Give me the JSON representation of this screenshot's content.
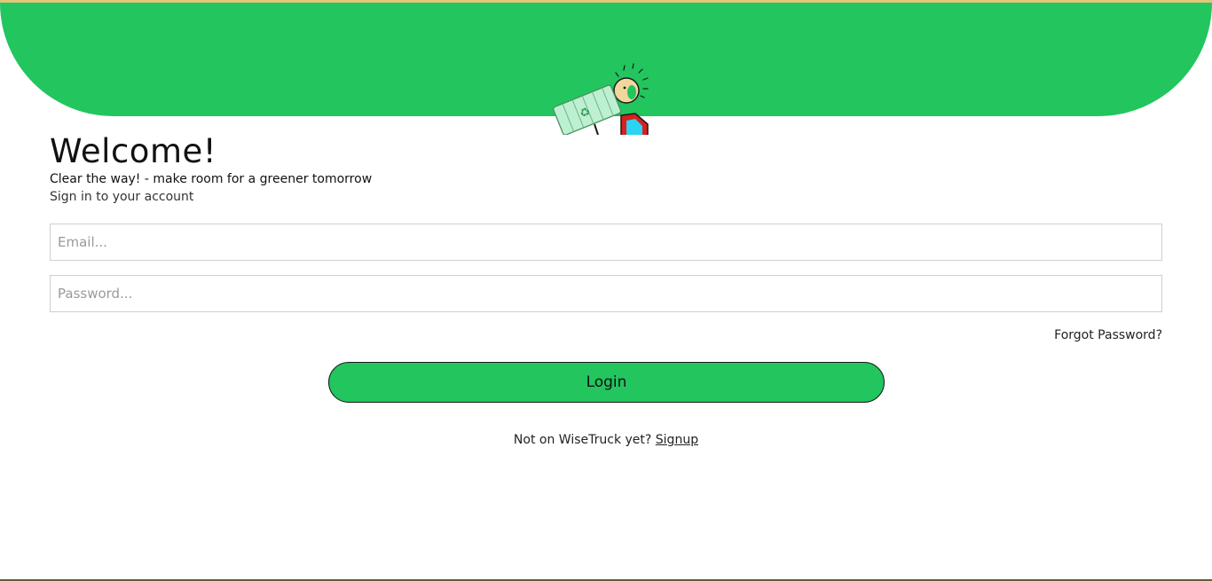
{
  "brand": {
    "accent_color": "#22c55e",
    "mascot_icon": "recycling-bin-mascot-icon"
  },
  "login": {
    "title": "Welcome!",
    "tagline": "Clear the way! - make room for a greener tomorrow",
    "subtitle": "Sign in to your account",
    "email_placeholder": "Email...",
    "password_placeholder": "Password...",
    "forgot_password": "Forgot Password?",
    "login_button": "Login",
    "signup_prompt": "Not on WiseTruck yet?",
    "signup_link": "Signup"
  }
}
